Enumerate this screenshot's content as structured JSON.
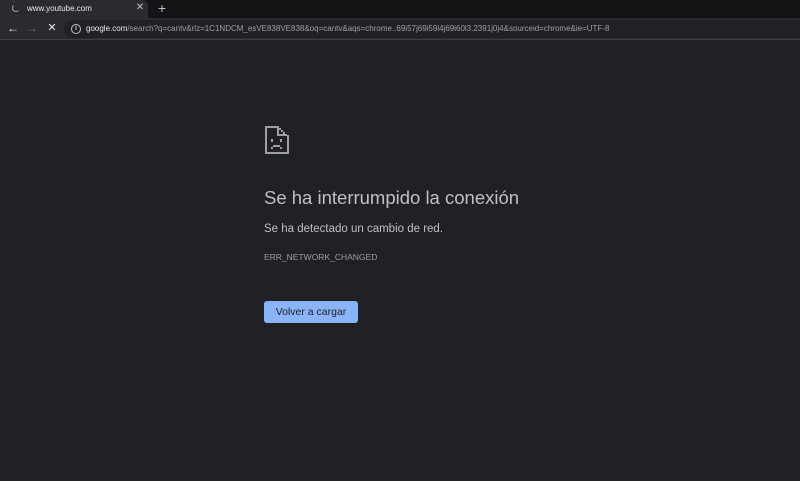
{
  "tab": {
    "title": "www.youtube.com",
    "close_glyph": "✕",
    "status_icon": "loading-spinner-icon"
  },
  "new_tab_glyph": "+",
  "toolbar": {
    "back_glyph": "←",
    "forward_glyph": "→",
    "stop_glyph": "✕",
    "info_glyph": "i"
  },
  "omnibox": {
    "host": "google.com",
    "path": "/search?q=cantv&rlz=1C1NDCM_esVE838VE838&oq=cantv&aqs=chrome..69i57j69i59l4j69i60l3.2391j0j4&sourceid=chrome&ie=UTF-8"
  },
  "error": {
    "icon": "sad-document-icon",
    "title": "Se ha interrumpido la conexión",
    "description": "Se ha detectado un cambio de red.",
    "code": "ERR_NETWORK_CHANGED",
    "reload_label": "Volver a cargar"
  },
  "colors": {
    "page_background": "#202124",
    "text": "#bdc1c6",
    "button": "#8ab4f8"
  }
}
